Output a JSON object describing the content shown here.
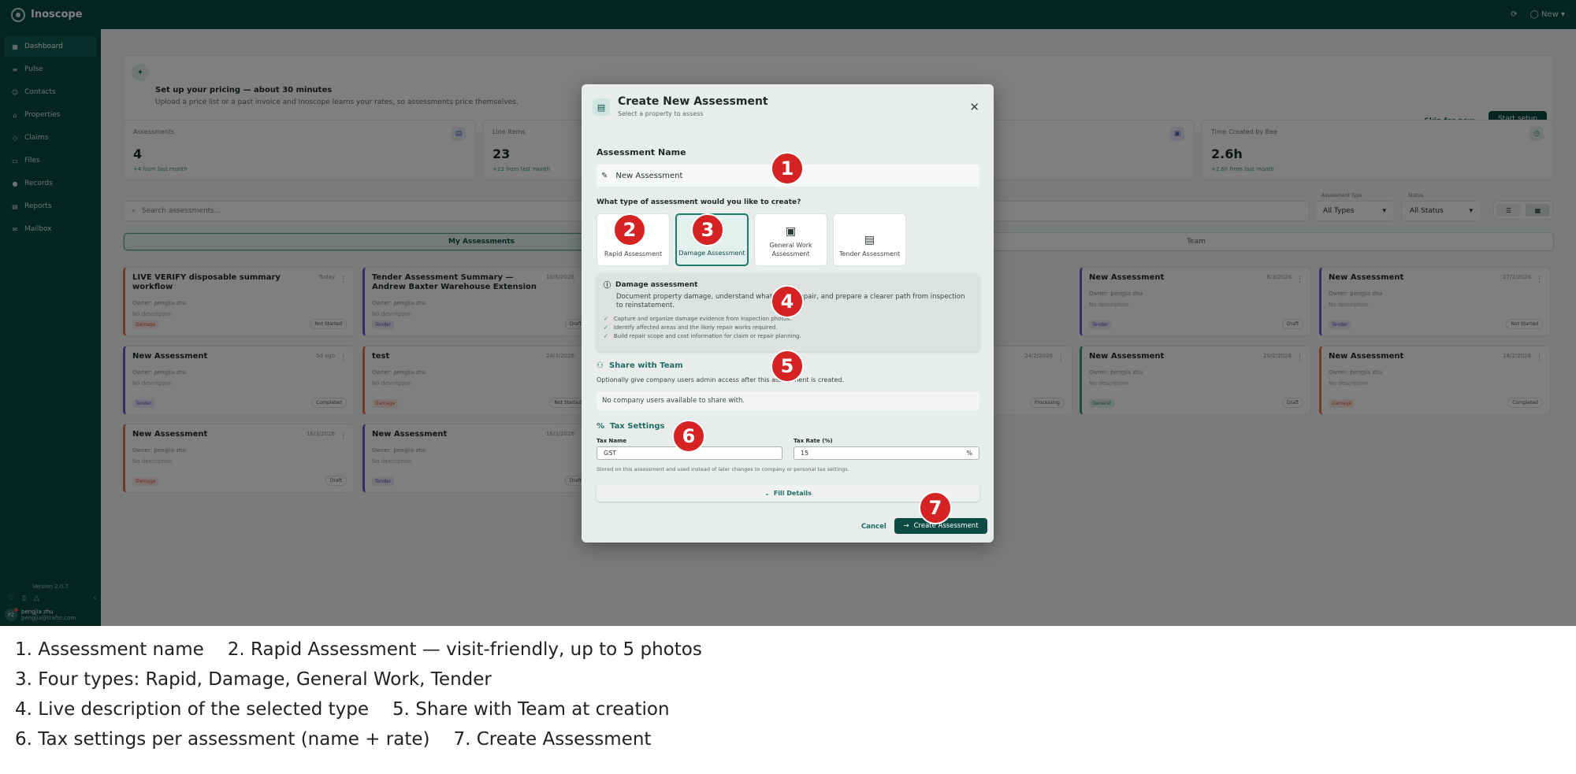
{
  "app": {
    "name": "Inoscope",
    "new_label": "New"
  },
  "sidebar": {
    "items": [
      {
        "label": "Dashboard",
        "icon": "grid-icon",
        "active": true
      },
      {
        "label": "Pulse",
        "icon": "pulse-icon"
      },
      {
        "label": "Contacts",
        "icon": "contacts-icon"
      },
      {
        "label": "Properties",
        "icon": "home-icon"
      },
      {
        "label": "Claims",
        "icon": "shield-icon"
      },
      {
        "label": "Files",
        "icon": "folder-icon"
      },
      {
        "label": "Records",
        "icon": "mic-icon"
      },
      {
        "label": "Reports",
        "icon": "report-icon"
      },
      {
        "label": "Mailbox",
        "icon": "mail-icon"
      }
    ],
    "version": "Version 2.0.7",
    "user_initials": "PZ",
    "user_name": "pengjia zhu",
    "user_email": "pengjia@trafte.com"
  },
  "banner": {
    "title": "Set up your pricing — about 30 minutes",
    "subtitle": "Upload a price list or a past invoice and Inoscope learns your rates, so assessments price themselves.",
    "skip_label": "Skip for now",
    "start_label": "Start setup"
  },
  "stats": [
    {
      "label": "Assessments",
      "value": "4",
      "delta": "+4 from last month"
    },
    {
      "label": "Line Items",
      "value": "23",
      "delta": "+23 from last month"
    },
    {
      "label": "Time Created by Bee",
      "value": "2.6h",
      "delta": "+2.6h from last month"
    }
  ],
  "search": {
    "placeholder": "Search assessments..."
  },
  "filters": {
    "type_label": "Assessment Type",
    "type_value": "All Types",
    "status_label": "Status",
    "status_value": "All Status"
  },
  "tabs": {
    "mine": "My Assessments",
    "team": "Team"
  },
  "cards": [
    {
      "title": "LIVE VERIFY disposable summary workflow",
      "date": "Today",
      "owner": "Owner: pengjia zhu",
      "desc": "No description",
      "tag": "Damage",
      "status": "Not Started"
    },
    {
      "title": "Tender Assessment Summary — Andrew Baxter Warehouse Extension",
      "date": "10/6/2026",
      "owner": "Owner: pengjia zhu",
      "desc": "No description",
      "tag": "Tender",
      "status": "Draft"
    },
    {
      "title": "New Assessment",
      "date": "5d ago",
      "owner": "Owner: pengjia zhu",
      "desc": "No description",
      "tag": "Tender",
      "status": "Completed"
    },
    {
      "title": "test",
      "date": "24/3/2026",
      "owner": "Owner: pengjia zhu",
      "desc": "No description",
      "tag": "Damage",
      "status": "Not Started"
    },
    {
      "title": "New Assessment",
      "date": "16/3/2026",
      "owner": "Owner: pengjia zhu",
      "desc": "No description",
      "tag": "Damage",
      "status": "Draft"
    },
    {
      "title": "New Assessment",
      "date": "16/3/2026",
      "owner": "Owner: pengjia zhu",
      "desc": "No description",
      "tag": "Tender",
      "status": "Draft"
    },
    {
      "title": "New Assessment",
      "date": "8/3/2026",
      "owner": "Owner: pengjia zhu",
      "desc": "No description",
      "tag": "Tender",
      "status": "Draft"
    },
    {
      "title": "New Assessment",
      "date": "27/2/2026",
      "owner": "Owner: pengjia zhu",
      "desc": "No description",
      "tag": "Tender",
      "status": "Not Started"
    },
    {
      "title": "New Assessment",
      "date": "24/2/2026",
      "owner": "Owner: pengjia zhu",
      "desc": "No description",
      "tag": "Tender",
      "status": "Processing"
    },
    {
      "title": "New Assessment",
      "date": "20/2/2026",
      "owner": "Owner: pengjia zhu",
      "desc": "No description",
      "tag": "General",
      "status": "Draft"
    },
    {
      "title": "New Assessment",
      "date": "18/2/2026",
      "owner": "Owner: pengjia zhu",
      "desc": "No description",
      "tag": "Damage",
      "status": "Completed"
    }
  ],
  "modal": {
    "title": "Create New Assessment",
    "subtitle": "Select a property to assess",
    "name_label": "Assessment Name",
    "name_value": "New Assessment",
    "type_question": "What type of assessment would you like to create?",
    "types": [
      {
        "label": "Rapid Assessment",
        "icon": "bolt-icon"
      },
      {
        "label": "Damage Assessment",
        "icon": "damage-icon",
        "selected": true
      },
      {
        "label": "General Work Assessment",
        "icon": "briefcase-icon"
      },
      {
        "label": "Tender Assessment",
        "icon": "document-icon"
      }
    ],
    "desc_title": "Damage assessment",
    "desc_text": "Document property damage, understand what needs repair, and prepare a clearer path from inspection to reinstatement.",
    "desc_points": [
      "Capture and organize damage evidence from inspection photos.",
      "Identify affected areas and the likely repair works required.",
      "Build repair scope and cost information for claim or repair planning."
    ],
    "share_title": "Share with Team",
    "share_text": "Optionally give company users admin access after this assessment is created.",
    "share_empty": "No company users available to share with.",
    "tax_title": "Tax Settings",
    "tax_name_label": "Tax Name",
    "tax_name_value": "GST",
    "tax_rate_label": "Tax Rate (%)",
    "tax_rate_value": "15",
    "tax_rate_unit": "%",
    "tax_note": "Stored on this assessment and used instead of later changes to company or personal tax settings.",
    "fill_details": "Fill Details",
    "cancel": "Cancel",
    "create": "Create Assessment"
  },
  "badges": [
    "1",
    "2",
    "3",
    "4",
    "5",
    "6",
    "7"
  ],
  "captions": [
    [
      "1. Assessment name",
      "2. Rapid Assessment — visit-friendly, up to 5 photos"
    ],
    [
      "3. Four types: Rapid, Damage, General Work, Tender"
    ],
    [
      "4. Live description of the selected type",
      "5. Share with Team at creation"
    ],
    [
      "6. Tax settings per assessment (name + rate)",
      "7. Create Assessment"
    ]
  ],
  "colors": {
    "brand": "#0c4b43",
    "badge": "#d52222",
    "accent": "#1f7a6c"
  }
}
